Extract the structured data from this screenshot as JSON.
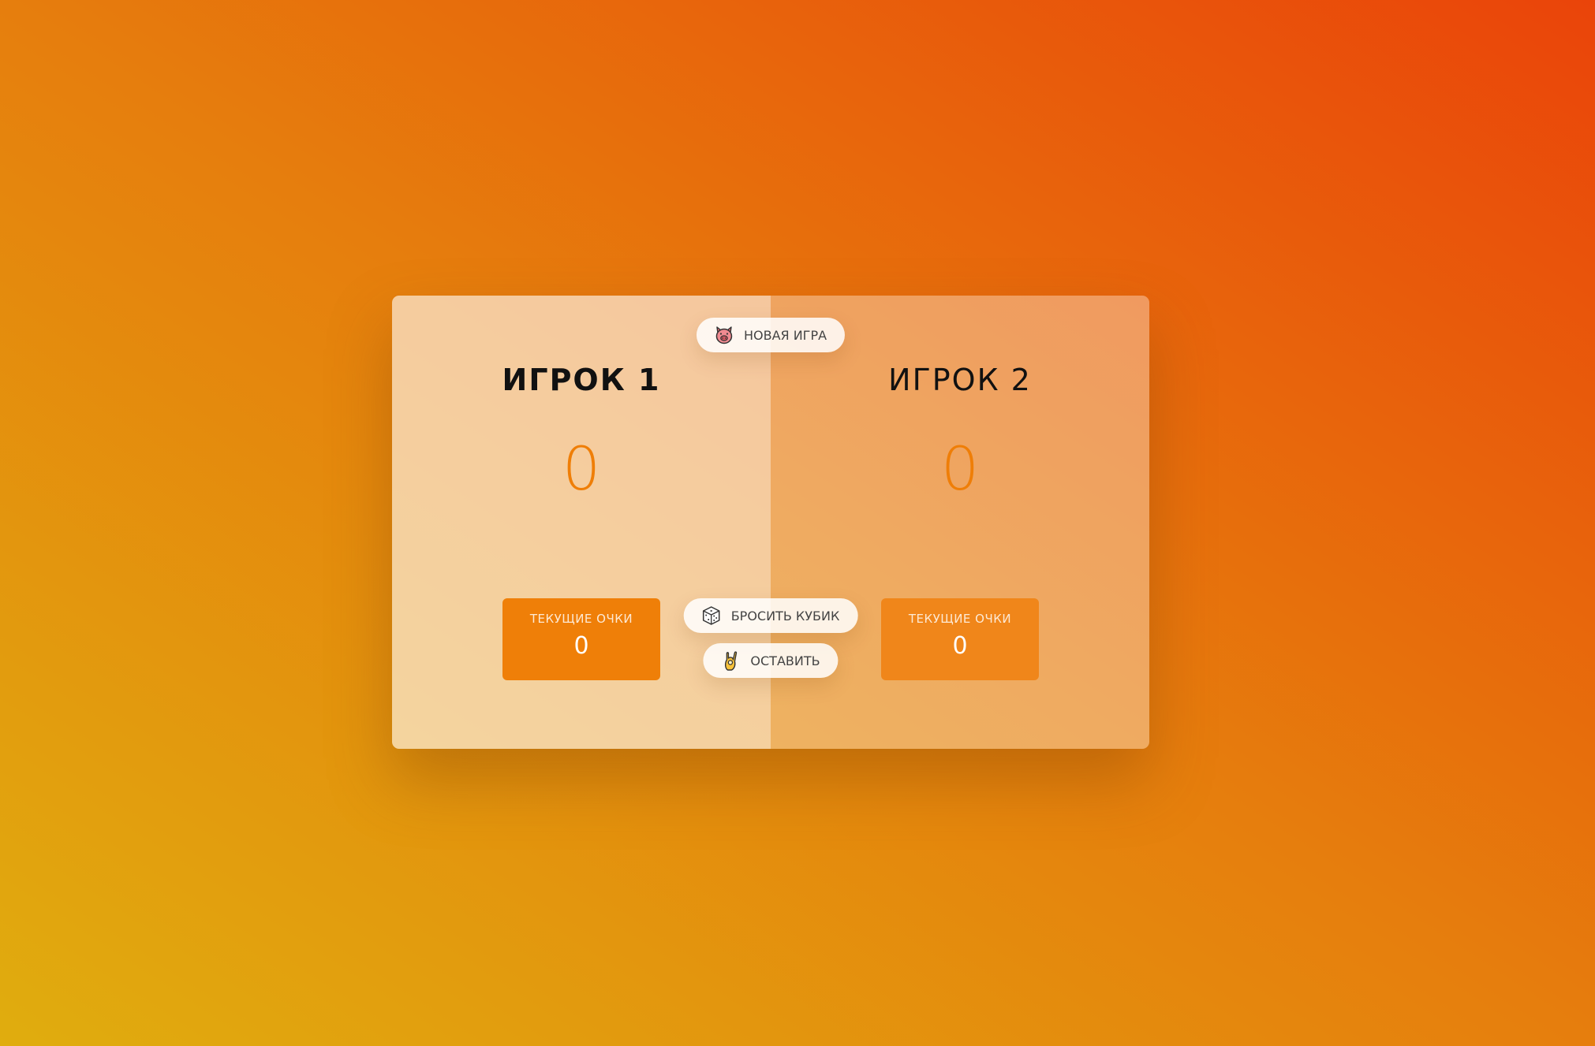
{
  "players": [
    {
      "name": "Игрок 1",
      "score": "0",
      "current_label": "Текущие очки",
      "current_score": "0",
      "active": true
    },
    {
      "name": "Игрок 2",
      "score": "0",
      "current_label": "Текущие очки",
      "current_score": "0",
      "active": false
    }
  ],
  "buttons": {
    "new_game": {
      "label": "Новая игра",
      "icon": "pig-icon"
    },
    "roll": {
      "label": "Бросить кубик",
      "icon": "dice-icon"
    },
    "hold": {
      "label": "Оставить",
      "icon": "ok-hand-icon"
    }
  },
  "colors": {
    "accent": "#ef7e07",
    "current_box": "#ef7f08",
    "background_start": "#e0ad0e",
    "background_end": "#ea440a"
  }
}
